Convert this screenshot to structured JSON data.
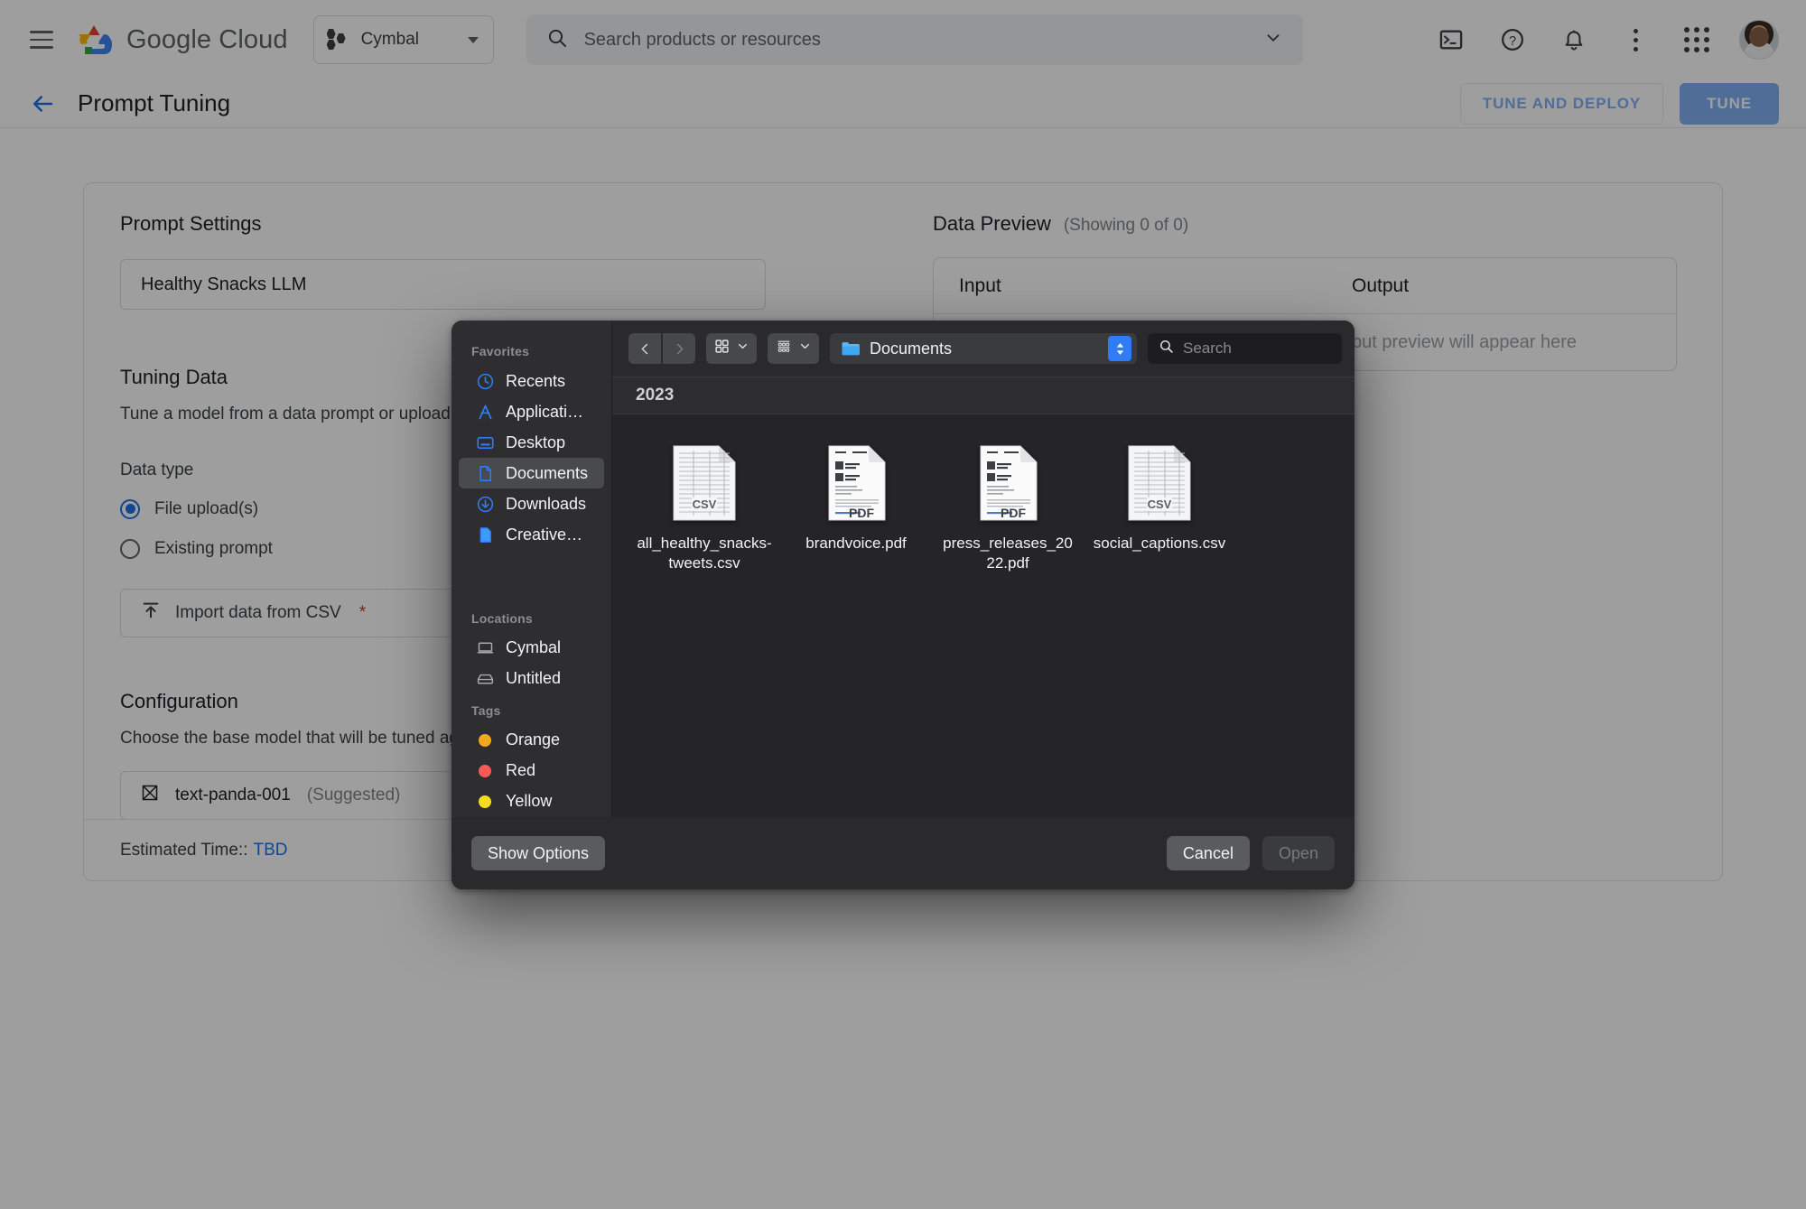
{
  "topbar": {
    "menu_icon": "hamburger-menu-icon",
    "brand": "Google Cloud",
    "brand_first": "Google",
    "brand_second": "Cloud",
    "project_name": "Cymbal",
    "search_placeholder": "Search products or resources",
    "search_value": "",
    "icons": [
      "terminal-icon",
      "help-icon",
      "notifications-icon",
      "more-vert-icon",
      "apps-grid-icon",
      "avatar"
    ]
  },
  "pagehead": {
    "back_label": "back-arrow",
    "title": "Prompt Tuning",
    "tune_and_deploy": "TUNE AND DEPLOY",
    "tune": "TUNE"
  },
  "left": {
    "prompt_settings_title": "Prompt Settings",
    "prompt_name_value": "Healthy Snacks LLM",
    "tuning_data_title": "Tuning Data",
    "tuning_data_desc": "Tune a model from a data prompt or upload a samples.",
    "data_type_label": "Data type",
    "radios": [
      {
        "label": "File upload(s)",
        "selected": true
      },
      {
        "label": "Existing prompt",
        "selected": false
      }
    ],
    "import_label": "Import data from CSV",
    "import_required_mark": "*",
    "configuration_title": "Configuration",
    "configuration_desc": "Choose the base model that will be tuned agai",
    "model_name": "text-panda-001",
    "model_suffix": "(Suggested)",
    "footer_label": "Estimated Time::",
    "footer_value": "TBD"
  },
  "preview": {
    "title": "Data Preview",
    "count": "(Showing 0 of 0)",
    "col_input": "Input",
    "col_output": "Output",
    "placeholder_output": "put preview will appear here"
  },
  "filedialog": {
    "sidebar": {
      "favorites_label": "Favorites",
      "favorites": [
        {
          "label": "Recents",
          "icon": "clock-icon",
          "selected": false
        },
        {
          "label": "Applicati…",
          "icon": "applications-icon",
          "selected": false
        },
        {
          "label": "Desktop",
          "icon": "desktop-icon",
          "selected": false
        },
        {
          "label": "Documents",
          "icon": "document-icon",
          "selected": true
        },
        {
          "label": "Downloads",
          "icon": "download-icon",
          "selected": false
        },
        {
          "label": "Creative…",
          "icon": "document-icon",
          "selected": false
        }
      ],
      "locations_label": "Locations",
      "locations": [
        {
          "label": "Cymbal",
          "icon": "laptop-icon"
        },
        {
          "label": "Untitled",
          "icon": "harddisk-icon"
        }
      ],
      "tags_label": "Tags",
      "tags": [
        {
          "label": "Orange",
          "color": "#f0a81e"
        },
        {
          "label": "Red",
          "color": "#fa5a55"
        },
        {
          "label": "Yellow",
          "color": "#f5dd1e"
        }
      ]
    },
    "toolbar": {
      "back_icon": "chevron-left-icon",
      "forward_icon": "chevron-right-icon",
      "icon_view_icon": "grid-view-icon",
      "group_view_icon": "group-view-icon",
      "path_label": "Documents",
      "path_icon": "folder-icon",
      "search_placeholder": "Search",
      "search_value": ""
    },
    "group_header": "2023",
    "files": [
      {
        "name": "all_healthy_snacks-tweets.csv",
        "type": "csv"
      },
      {
        "name": "brandvoice.pdf",
        "type": "pdf"
      },
      {
        "name": "press_releases_2022.pdf",
        "type": "pdf"
      },
      {
        "name": "social_captions.csv",
        "type": "csv"
      }
    ],
    "footer": {
      "show_options": "Show Options",
      "cancel": "Cancel",
      "open": "Open"
    }
  },
  "colors": {
    "accent_blue": "#1a73e8",
    "mac_blue": "#2f7cf6",
    "required_red": "#d93025",
    "input_bar": "#5b8dd9",
    "output_bar": "#7fba8f"
  }
}
